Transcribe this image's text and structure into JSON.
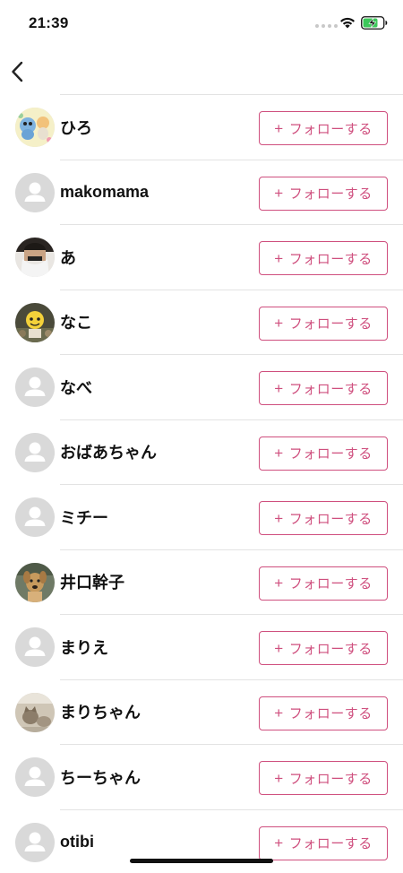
{
  "status_bar": {
    "time": "21:39"
  },
  "follow_label": "フォローする",
  "follow_plus": "+",
  "accent_color": "#cf4f7e",
  "users": [
    {
      "name": "ひろ",
      "avatar": "cartoon-photo"
    },
    {
      "name": "makomama",
      "avatar": "default"
    },
    {
      "name": "あ",
      "avatar": "person-photo"
    },
    {
      "name": "なこ",
      "avatar": "character-photo"
    },
    {
      "name": "なべ",
      "avatar": "default"
    },
    {
      "name": "おばあちゃん",
      "avatar": "default"
    },
    {
      "name": "ミチー",
      "avatar": "default"
    },
    {
      "name": "井口幹子",
      "avatar": "dog-photo"
    },
    {
      "name": "まりえ",
      "avatar": "default"
    },
    {
      "name": "まりちゃん",
      "avatar": "cat-photo"
    },
    {
      "name": "ちーちゃん",
      "avatar": "default"
    },
    {
      "name": "otibi",
      "avatar": "default"
    }
  ]
}
